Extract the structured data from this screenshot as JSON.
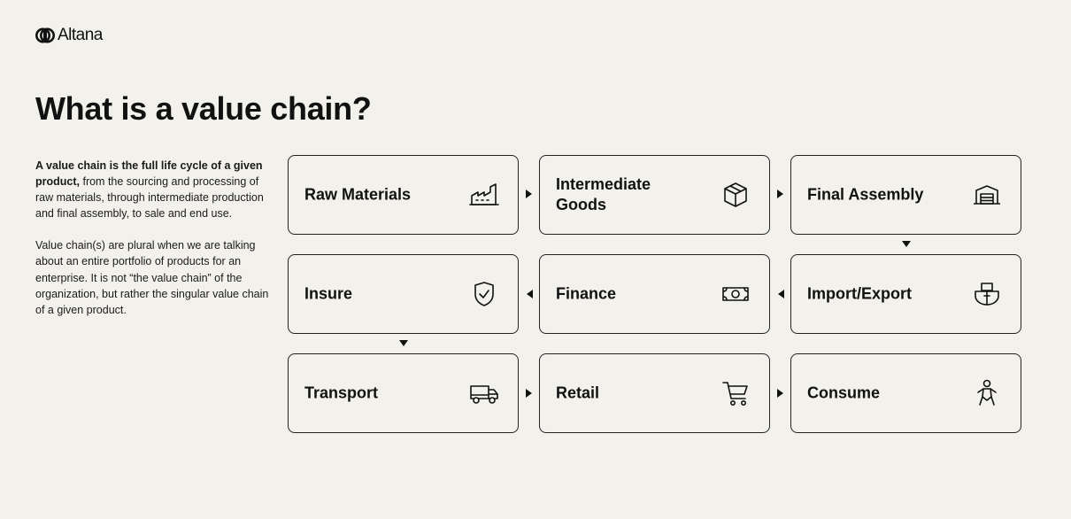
{
  "brand": {
    "name": "Altana"
  },
  "title": "What is a value chain?",
  "description": {
    "p1_bold": "A value chain is the full life cycle of a given product,",
    "p1_rest": " from the sourcing and processing of raw materials, through intermediate production and final assembly, to sale and end use.",
    "p2": "Value chain(s) are plural when we are talking about an entire portfolio of products for an enterprise. It is not “the value chain” of the organization, but rather the singular value chain of a given product."
  },
  "steps": [
    {
      "label": "Raw Materials",
      "icon": "factory-icon"
    },
    {
      "label": "Intermediate Goods",
      "icon": "box-icon"
    },
    {
      "label": "Final Assembly",
      "icon": "warehouse-icon"
    },
    {
      "label": "Import/Export",
      "icon": "ship-icon"
    },
    {
      "label": "Finance",
      "icon": "banknote-icon"
    },
    {
      "label": "Insure",
      "icon": "shield-check-icon"
    },
    {
      "label": "Transport",
      "icon": "truck-icon"
    },
    {
      "label": "Retail",
      "icon": "shopping-cart-icon"
    },
    {
      "label": "Consume",
      "icon": "person-icon"
    }
  ],
  "colors": {
    "background": "#f3f1ec",
    "ink": "#111111"
  }
}
